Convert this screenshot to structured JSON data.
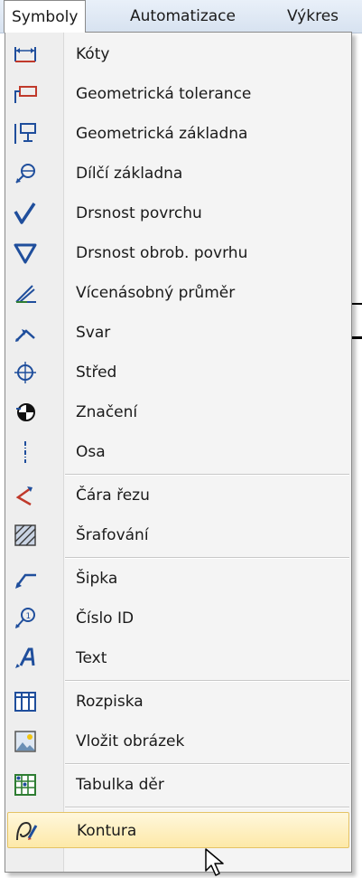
{
  "menubar": {
    "items": [
      {
        "label": "Symboly"
      },
      {
        "label": "Automatizace"
      },
      {
        "label": "Výkres"
      }
    ]
  },
  "menu": {
    "items": [
      {
        "label": "Kóty",
        "icon": "dimension-icon"
      },
      {
        "label": "Geometrická tolerance",
        "icon": "geometric-tolerance-icon"
      },
      {
        "label": "Geometrická základna",
        "icon": "datum-icon"
      },
      {
        "label": "Dílčí základna",
        "icon": "datum-target-icon"
      },
      {
        "label": "Drsnost povrchu",
        "icon": "surface-roughness-icon"
      },
      {
        "label": "Drsnost obrob. povrhu",
        "icon": "machined-roughness-icon"
      },
      {
        "label": "Vícenásobný průměr",
        "icon": "multiple-diameter-icon"
      },
      {
        "label": "Svar",
        "icon": "weld-icon"
      },
      {
        "label": "Střed",
        "icon": "center-mark-icon"
      },
      {
        "label": "Značení",
        "icon": "marking-icon"
      },
      {
        "label": "Osa",
        "icon": "axis-icon"
      },
      {
        "label": "Čára řezu",
        "icon": "section-line-icon"
      },
      {
        "label": "Šrafování",
        "icon": "hatching-icon"
      },
      {
        "label": "Šipka",
        "icon": "arrow-icon"
      },
      {
        "label": "Číslo ID",
        "icon": "balloon-id-icon"
      },
      {
        "label": "Text",
        "icon": "text-icon"
      },
      {
        "label": "Rozpiska",
        "icon": "bill-of-materials-icon"
      },
      {
        "label": "Vložit obrázek",
        "icon": "insert-image-icon"
      },
      {
        "label": "Tabulka děr",
        "icon": "hole-table-icon"
      },
      {
        "label": "Kontura",
        "icon": "contour-icon"
      }
    ],
    "highlighted": "Kontura"
  },
  "colors": {
    "highlight": "#fde9a8",
    "icon_blue": "#1f4e9c",
    "icon_red": "#c0392b",
    "icon_green": "#2e7d32"
  }
}
